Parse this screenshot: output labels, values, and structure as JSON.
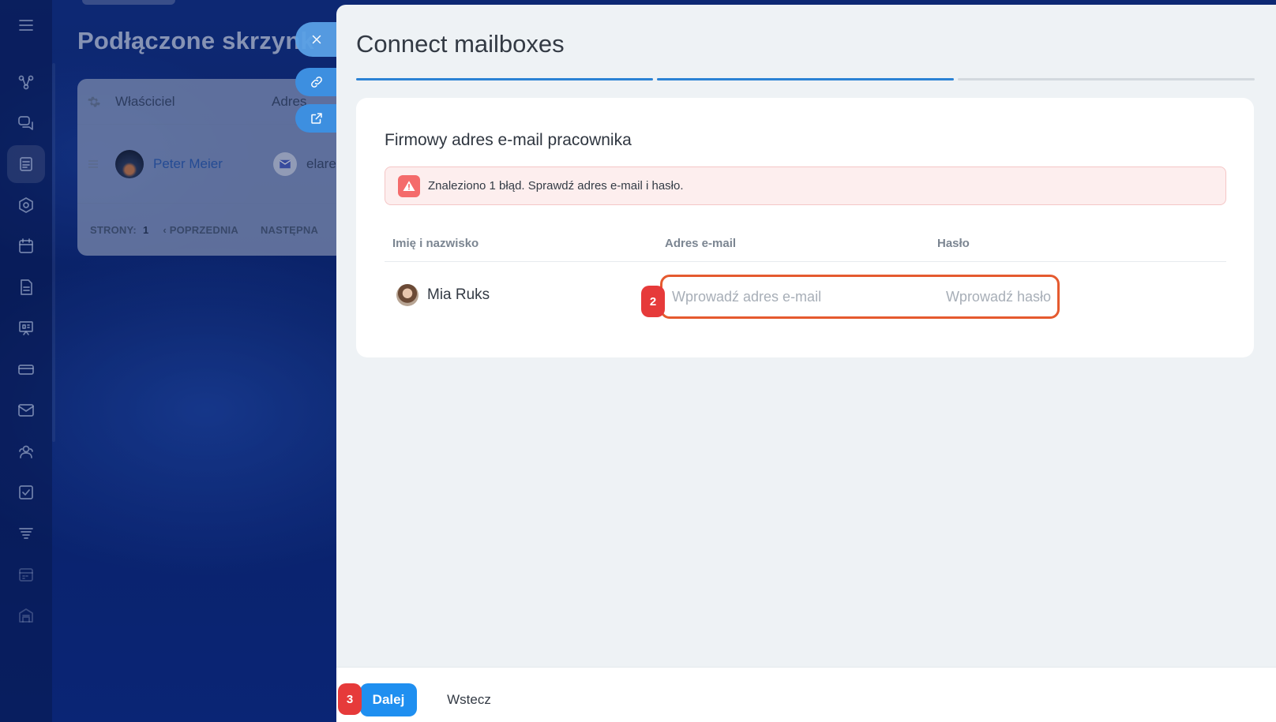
{
  "background_page": {
    "title": "Podłączone skrzynk",
    "table": {
      "col_owner": "Właściciel",
      "col_address": "Adres",
      "row": {
        "name": "Peter Meier",
        "address": "elare"
      },
      "pager": {
        "pages_label": "STRONY:",
        "pages_value": "1",
        "prev": "POPRZEDNIA",
        "next": "NASTĘPNA"
      }
    }
  },
  "panel": {
    "title": "Connect mailboxes",
    "steps": [
      {
        "done": true
      },
      {
        "done": true
      },
      {
        "done": false
      }
    ],
    "card": {
      "title": "Firmowy adres e-mail pracownika",
      "alert": "Znaleziono 1 błąd. Sprawdź adres e-mail i hasło.",
      "columns": {
        "name": "Imię i nazwisko",
        "email": "Adres e-mail",
        "password": "Hasło"
      },
      "row": {
        "name": "Mia Ruks",
        "email_placeholder": "Wprowadź adres e-mail",
        "password_placeholder": "Wprowadź hasło"
      }
    },
    "footer": {
      "next": "Dalej",
      "back": "Wstecz"
    }
  },
  "annotations": {
    "step2": "2",
    "step3": "3"
  },
  "colors": {
    "accent": "#1f8ff0",
    "error_outline": "#e55a2f",
    "badge": "#e63a3a",
    "progress": "#2b82d4"
  },
  "icons": [
    "menu-icon",
    "close-icon",
    "link-icon",
    "external-link-icon",
    "warning-icon",
    "gear-icon",
    "mail-icon"
  ]
}
